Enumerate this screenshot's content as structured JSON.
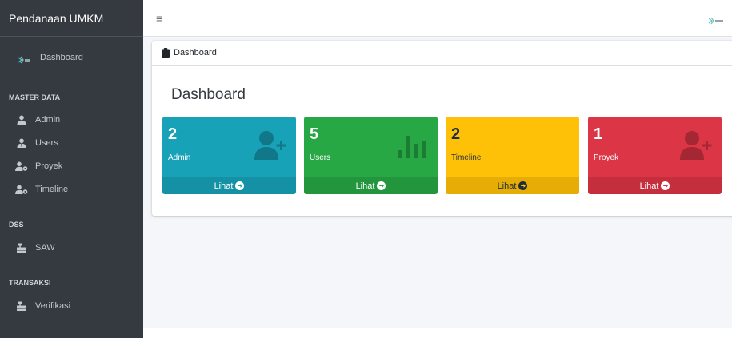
{
  "sidebar": {
    "brand": "Pendanaan UMKM",
    "main_item": {
      "label": "Dashboard",
      "icon": "umkm-logo-icon"
    },
    "sections": [
      {
        "header": "MASTER DATA",
        "items": [
          {
            "label": "Admin",
            "icon": "user-icon"
          },
          {
            "label": "Users",
            "icon": "user-tie-icon"
          },
          {
            "label": "Proyek",
            "icon": "users-cog-icon"
          },
          {
            "label": "Timeline",
            "icon": "users-cog-icon"
          }
        ]
      },
      {
        "header": "DSS",
        "items": [
          {
            "label": "SAW",
            "icon": "cash-register-icon"
          }
        ]
      },
      {
        "header": "TRANSAKSI",
        "items": [
          {
            "label": "Verifikasi",
            "icon": "cash-register-icon"
          }
        ]
      }
    ]
  },
  "topbar": {
    "menu_icon": "≡"
  },
  "card": {
    "header": "Dashboard",
    "title": "Dashboard"
  },
  "boxes": [
    {
      "count": "2",
      "label": "Admin",
      "footer": "Lihat",
      "color": "#17a2b8",
      "icon": "user-plus-icon"
    },
    {
      "count": "5",
      "label": "Users",
      "footer": "Lihat",
      "color": "#28a745",
      "icon": "bar-chart-icon"
    },
    {
      "count": "2",
      "label": "Timeline",
      "footer": "Lihat",
      "color": "#ffc107",
      "icon": "none"
    },
    {
      "count": "1",
      "label": "Proyek",
      "footer": "Lihat",
      "color": "#dc3545",
      "icon": "user-plus-icon"
    }
  ]
}
